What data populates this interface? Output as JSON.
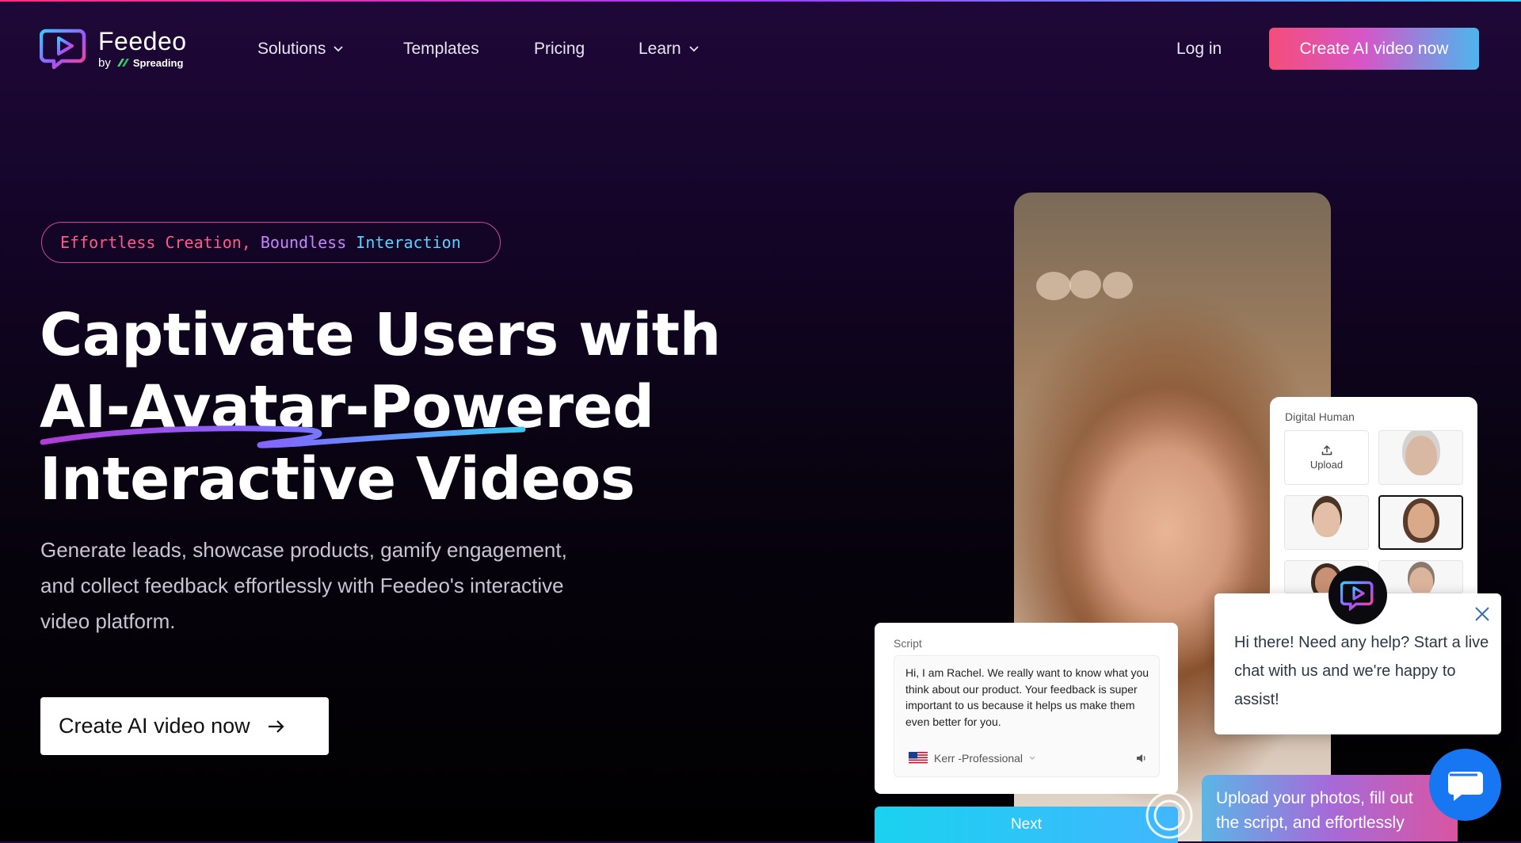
{
  "brand": {
    "name": "Feedeo",
    "by": "by",
    "parent": "Spreading"
  },
  "nav": {
    "items": [
      {
        "label": "Solutions",
        "dropdown": true
      },
      {
        "label": "Templates",
        "dropdown": false
      },
      {
        "label": "Pricing",
        "dropdown": false
      },
      {
        "label": "Learn",
        "dropdown": true
      }
    ],
    "login": "Log in",
    "cta": "Create AI video now"
  },
  "hero": {
    "tagline": {
      "part1": "Effortless Creation,",
      "part2": "Boundless",
      "part3": "Interaction"
    },
    "headline": {
      "line1": "Captivate Users with",
      "line2": "AI-Avatar-Powered",
      "line3": "Interactive Videos"
    },
    "subtitle": "Generate leads, showcase products, gamify engagement, and collect feedback effortlessly with Feedeo's interactive video platform.",
    "cta": "Create AI video now"
  },
  "demo": {
    "digital_human": {
      "title": "Digital Human",
      "upload_label": "Upload"
    },
    "script": {
      "label": "Script",
      "text": "Hi, I am Rachel. We really want to know what you think about our product. Your feedback is super important to us because it helps us make them even better for you.",
      "voice": "Kerr -Professional"
    },
    "next_label": "Next",
    "upload_tip": {
      "line1": "Upload your photos, fill out",
      "line2": "the script, and effortlessly"
    }
  },
  "chat": {
    "message": "Hi there! Need any help? Start a live chat with us and we're happy to assist!"
  },
  "colors": {
    "accent_pink": "#f54d7a",
    "accent_purple": "#c685ff",
    "accent_blue": "#4cb6ee",
    "chat_blue": "#1777f2"
  },
  "icons": [
    "feedeo-logo-icon",
    "spreading-logo-icon",
    "chevron-down-icon",
    "arrow-right-icon",
    "upload-icon",
    "flag-us-icon",
    "speaker-icon",
    "close-icon",
    "chat-bubble-icon"
  ]
}
